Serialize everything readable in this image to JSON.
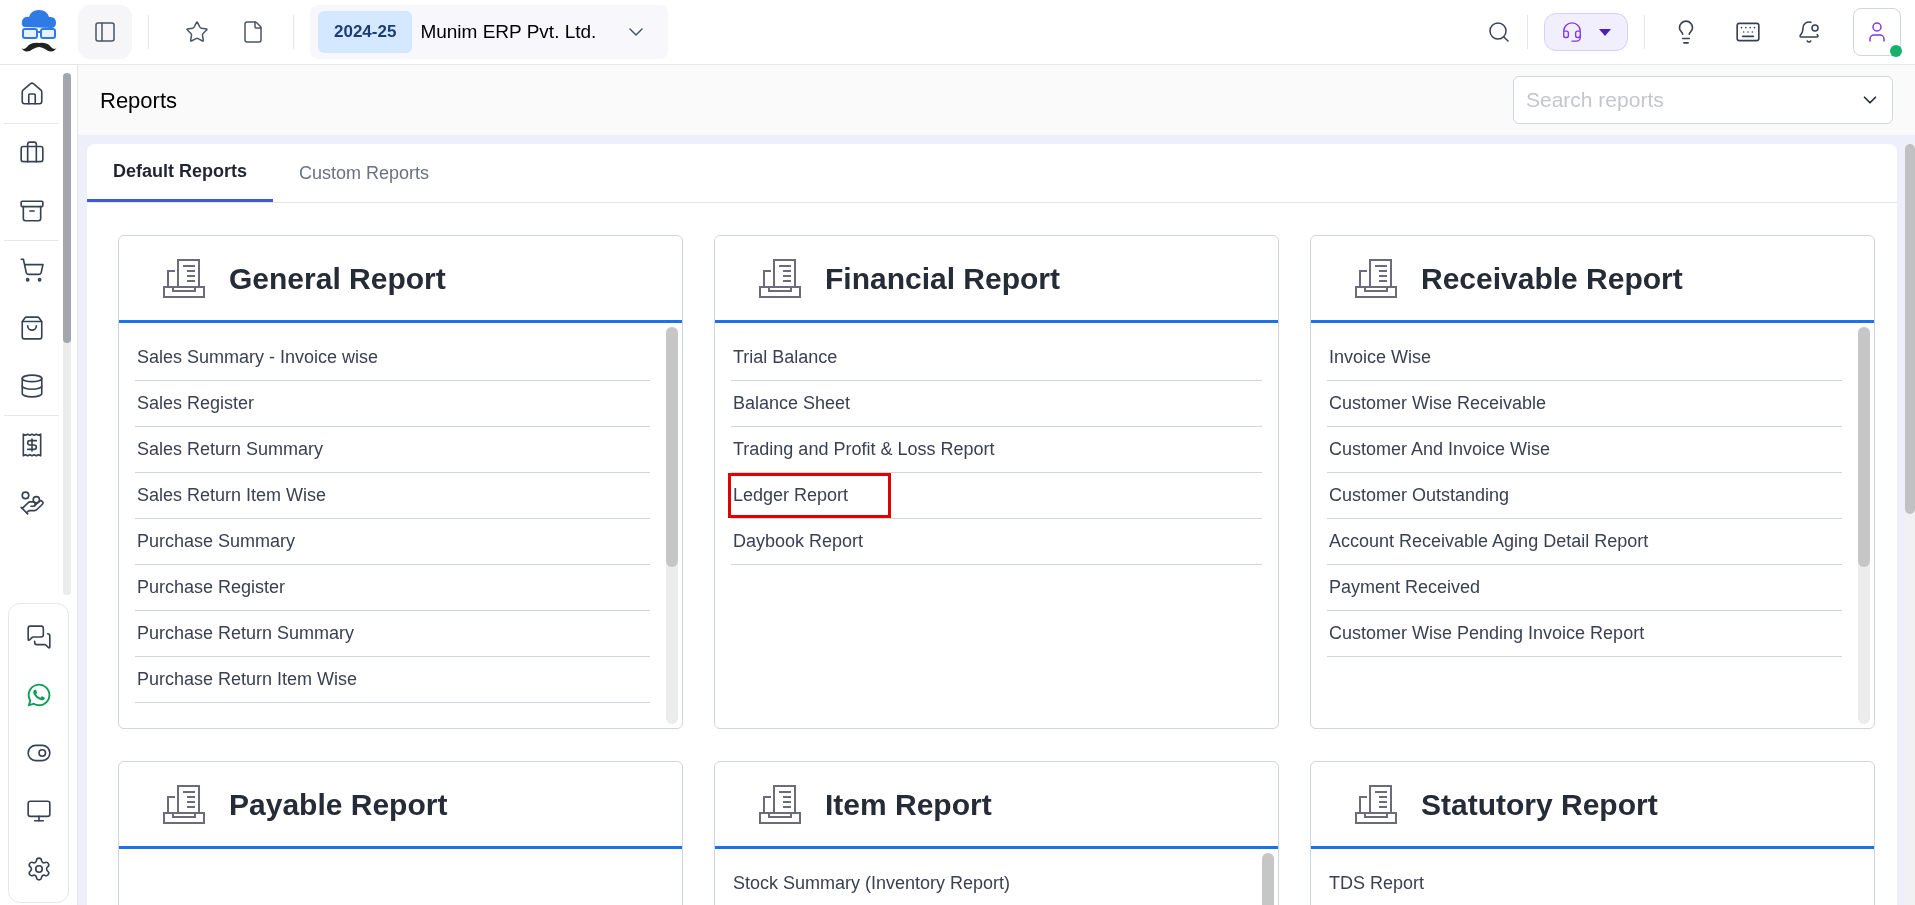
{
  "header": {
    "fiscal_year": "2024-25",
    "company": "Munim ERP Pvt. Ltd."
  },
  "page_title": "Reports",
  "search": {
    "placeholder": "Search reports"
  },
  "tabs": [
    {
      "label": "Default Reports",
      "selected": true
    },
    {
      "label": "Custom Reports",
      "selected": false
    }
  ],
  "cards": [
    {
      "title": "General Report",
      "scrollbar": true,
      "items": [
        {
          "label": "Sales Summary - Invoice wise",
          "highlighted": false
        },
        {
          "label": "Sales Register",
          "highlighted": false
        },
        {
          "label": "Sales Return Summary",
          "highlighted": false
        },
        {
          "label": "Sales Return Item Wise",
          "highlighted": false
        },
        {
          "label": "Purchase Summary",
          "highlighted": false
        },
        {
          "label": "Purchase Register",
          "highlighted": false
        },
        {
          "label": "Purchase Return Summary",
          "highlighted": false
        },
        {
          "label": "Purchase Return Item Wise",
          "highlighted": false
        }
      ]
    },
    {
      "title": "Financial Report",
      "scrollbar": false,
      "items": [
        {
          "label": "Trial Balance",
          "highlighted": false
        },
        {
          "label": "Balance Sheet",
          "highlighted": false
        },
        {
          "label": "Trading and Profit & Loss Report",
          "highlighted": false
        },
        {
          "label": "Ledger Report",
          "highlighted": true
        },
        {
          "label": "Daybook Report",
          "highlighted": false
        }
      ]
    },
    {
      "title": "Receivable Report",
      "scrollbar": true,
      "items": [
        {
          "label": "Invoice Wise",
          "highlighted": false
        },
        {
          "label": "Customer Wise Receivable",
          "highlighted": false
        },
        {
          "label": "Customer And Invoice Wise",
          "highlighted": false
        },
        {
          "label": "Customer Outstanding",
          "highlighted": false
        },
        {
          "label": "Account Receivable Aging Detail Report",
          "highlighted": false
        },
        {
          "label": "Payment Received",
          "highlighted": false
        },
        {
          "label": "Customer Wise Pending Invoice Report",
          "highlighted": false
        }
      ]
    },
    {
      "title": "Payable Report",
      "scrollbar": false
    },
    {
      "title": "Item Report",
      "scrollbar": true,
      "items": [
        {
          "label": "Stock Summary (Inventory Report)",
          "highlighted": false
        }
      ]
    },
    {
      "title": "Statutory Report",
      "scrollbar": false,
      "items": [
        {
          "label": "TDS Report",
          "highlighted": false
        }
      ]
    }
  ]
}
